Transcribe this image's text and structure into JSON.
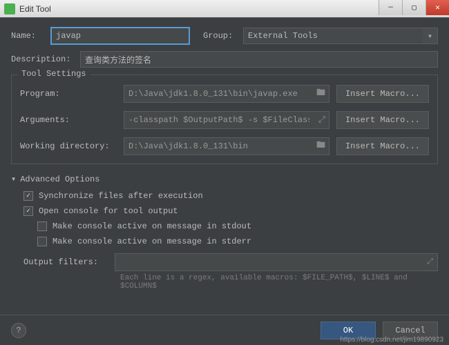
{
  "window": {
    "title": "Edit Tool"
  },
  "form": {
    "name_label": "Name:",
    "name_value": "javap",
    "group_label": "Group:",
    "group_value": "External Tools",
    "desc_label": "Description:",
    "desc_value": "查询类方法的签名"
  },
  "tool_settings": {
    "title": "Tool Settings",
    "program_label": "Program:",
    "program_value": "D:\\Java\\jdk1.8.0_131\\bin\\javap.exe",
    "arguments_label": "Arguments:",
    "arguments_value": "-classpath $OutputPath$ -s $FileClass$",
    "workdir_label": "Working directory:",
    "workdir_value": "D:\\Java\\jdk1.8.0_131\\bin",
    "insert_macro": "Insert Macro..."
  },
  "advanced": {
    "title": "Advanced Options",
    "sync": "Synchronize files after execution",
    "open_console": "Open console for tool output",
    "active_stdout": "Make console active on message in stdout",
    "active_stderr": "Make console active on message in stderr",
    "output_filters_label": "Output filters:",
    "hint": "Each line is a regex, available macros: $FILE_PATH$, $LINE$ and $COLUMN$"
  },
  "footer": {
    "ok": "OK",
    "cancel": "Cancel"
  },
  "watermark": "https://blog.csdn.net/jim19890923"
}
